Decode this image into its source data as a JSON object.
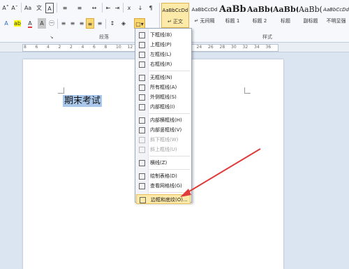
{
  "toolbar": {
    "row1": [
      "A˚",
      "A˘",
      "Aa",
      "文",
      "A",
      "≡",
      "≡",
      "↔",
      "⇤",
      "⇥",
      "ⅹ",
      "↓",
      "¶"
    ],
    "font_color_letter": "A",
    "highlight_letter": "ab",
    "paragraph_group_label": "段落",
    "styles_group_label": "样式"
  },
  "styles": [
    {
      "sample": "AaBbCcDd",
      "name": "↵ 正文",
      "selected": true
    },
    {
      "sample": "AaBbCcDd",
      "name": "↵ 无间隔",
      "selected": false
    },
    {
      "sample": "AaBb",
      "name": "标题 1",
      "selected": false
    },
    {
      "sample": "AaBb(",
      "name": "标题 2",
      "selected": false
    },
    {
      "sample": "AaBb(",
      "name": "标题",
      "selected": false
    },
    {
      "sample": "AaBb(",
      "name": "副标题",
      "selected": false
    },
    {
      "sample": "AaBbCcDd",
      "name": "不明显强",
      "selected": false
    }
  ],
  "ruler": {
    "numbers": [
      "8",
      "6",
      "4",
      "2",
      "2",
      "4",
      "6",
      "8",
      "10",
      "12",
      "14",
      "16",
      "18",
      "20",
      "22",
      "24",
      "26",
      "28",
      "30",
      "32",
      "34",
      "36"
    ]
  },
  "document": {
    "text": "期末考试"
  },
  "border_menu": {
    "items": [
      {
        "label": "下框线(B)",
        "disabled": false
      },
      {
        "label": "上框线(P)",
        "disabled": false
      },
      {
        "label": "左框线(L)",
        "disabled": false
      },
      {
        "label": "右框线(R)",
        "disabled": false
      },
      {
        "label": "无框线(N)",
        "disabled": false
      },
      {
        "label": "所有框线(A)",
        "disabled": false
      },
      {
        "label": "外侧框线(S)",
        "disabled": false
      },
      {
        "label": "内部框线(I)",
        "disabled": false
      },
      {
        "label": "内部横框线(H)",
        "disabled": false
      },
      {
        "label": "内部竖框线(V)",
        "disabled": false
      },
      {
        "label": "斜下框线(W)",
        "disabled": true
      },
      {
        "label": "斜上框线(U)",
        "disabled": true
      },
      {
        "label": "横线(Z)",
        "disabled": false
      },
      {
        "label": "绘制表格(D)",
        "disabled": false
      },
      {
        "label": "查看网格线(G)",
        "disabled": false
      },
      {
        "label": "边框和底纹(O)...",
        "disabled": false,
        "highlighted": true
      }
    ]
  },
  "colors": {
    "accent_arrow": "#e03a3a",
    "selection": "#a9c7ea",
    "highlight": "#fde9a8"
  }
}
